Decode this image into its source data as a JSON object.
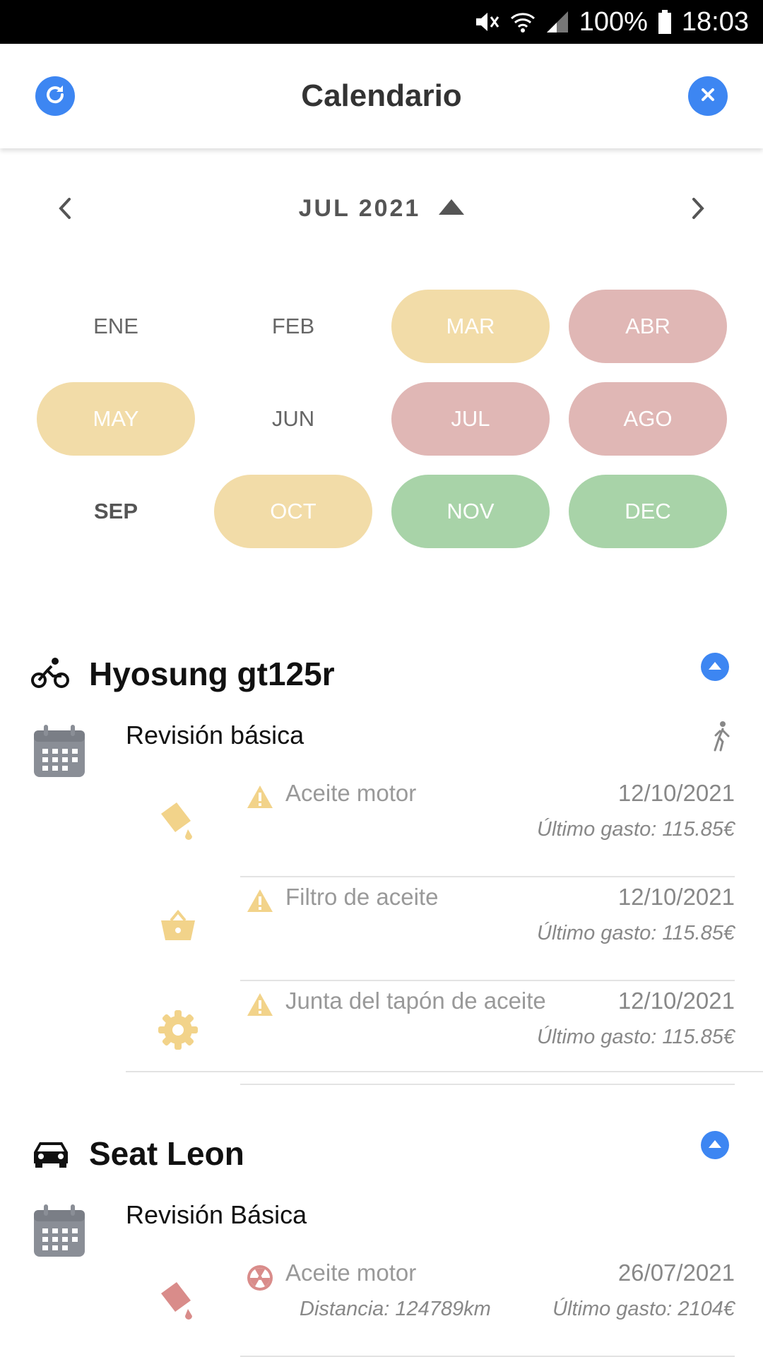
{
  "status_bar": {
    "battery": "100%",
    "time": "18:03"
  },
  "header": {
    "title": "Calendario"
  },
  "calendar": {
    "current_label": "JUL 2021",
    "months": [
      {
        "label": "ENE",
        "status": "none"
      },
      {
        "label": "FEB",
        "status": "none"
      },
      {
        "label": "MAR",
        "status": "yellow"
      },
      {
        "label": "ABR",
        "status": "red"
      },
      {
        "label": "MAY",
        "status": "yellow"
      },
      {
        "label": "JUN",
        "status": "none"
      },
      {
        "label": "JUL",
        "status": "red"
      },
      {
        "label": "AGO",
        "status": "red"
      },
      {
        "label": "SEP",
        "status": "current"
      },
      {
        "label": "OCT",
        "status": "yellow"
      },
      {
        "label": "NOV",
        "status": "green"
      },
      {
        "label": "DEC",
        "status": "green"
      }
    ]
  },
  "colors": {
    "accent": "#3d86f2",
    "warning": "#f2d38a",
    "danger": "#d98c8a",
    "ok": "#a8d3a8"
  },
  "vehicles": [
    {
      "name": "Hyosung gt125r",
      "icon": "motorcycle-icon",
      "revision": "Revisión básica",
      "tasks": [
        {
          "name": "Aceite motor",
          "date": "12/10/2021",
          "cost": "Último gasto: 115.85€",
          "icon": "oil-can-icon",
          "status": "warning-icon"
        },
        {
          "name": "Filtro de aceite",
          "date": "12/10/2021",
          "cost": "Último gasto: 115.85€",
          "icon": "basket-icon",
          "status": "warning-icon"
        },
        {
          "name": "Junta del tapón de aceite",
          "date": "12/10/2021",
          "cost": "Último gasto: 115.85€",
          "icon": "gear-icon",
          "status": "warning-icon"
        }
      ]
    },
    {
      "name": "Seat Leon",
      "icon": "car-icon",
      "revision": "Revisión Básica",
      "tasks": [
        {
          "name": "Aceite motor",
          "date": "26/07/2021",
          "distance": "Distancia: 124789km",
          "cost": "Último gasto: 2104€",
          "icon": "oil-can-icon",
          "status": "radiation-icon"
        }
      ]
    }
  ]
}
